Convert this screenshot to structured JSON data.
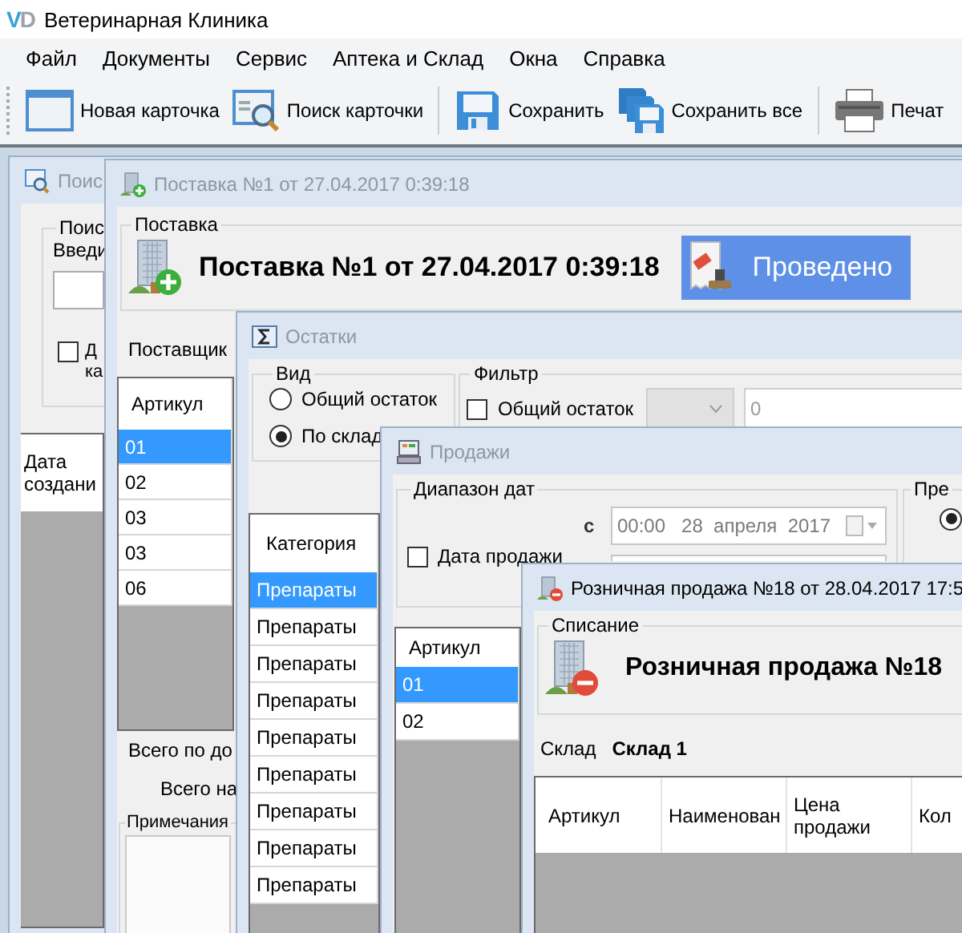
{
  "app": {
    "logo_v": "V",
    "logo_d": "D",
    "title": "Ветеринарная Клиника"
  },
  "menu": [
    "Файл",
    "Документы",
    "Сервис",
    "Аптека и Склад",
    "Окна",
    "Справка"
  ],
  "toolbar": [
    [
      {
        "label": "Новая карточка"
      },
      {
        "label": "Поиск карточки"
      }
    ],
    [
      {
        "label": "Сохранить"
      },
      {
        "label": "Сохранить все"
      }
    ],
    [
      {
        "label": "Печат"
      }
    ]
  ],
  "windows": [
    {
      "kind": "search",
      "title": "Поис",
      "active": false,
      "group_label": "Поис",
      "prompt": "Введи",
      "checked": false,
      "check_label_lines": [
        "Д",
        "ка"
      ],
      "table": {
        "columns": [
          "Дата создани"
        ]
      }
    },
    {
      "kind": "supply",
      "title": "Поставка №1 от 27.04.2017 0:39:18",
      "active": false,
      "group_label": "Поставка",
      "heading": "Поставка №1 от 27.04.2017 0:39:18",
      "status": "Проведено",
      "supplier_label": "Поставщик",
      "table": {
        "columns": [
          "Артикул"
        ],
        "rows": [
          {
            "cells": [
              "01"
            ],
            "selected": true
          },
          {
            "cells": [
              "02"
            ],
            "selected": false
          },
          {
            "cells": [
              "03"
            ],
            "selected": false
          },
          {
            "cells": [
              "03"
            ],
            "selected": false
          },
          {
            "cells": [
              "06"
            ],
            "selected": false
          }
        ]
      },
      "total_doc": "Всего по до",
      "total_sum": "Всего на",
      "notes_label": "Примечания"
    },
    {
      "kind": "stock",
      "title": "Остатки",
      "active": false,
      "view_label": "Вид",
      "view_options": [
        {
          "label": "Общий остаток",
          "selected": false
        },
        {
          "label": "По склад",
          "selected": true
        }
      ],
      "filter_label": "Фильтр",
      "filter_check": {
        "label": "Общий остаток",
        "checked": false
      },
      "filter_value": "0",
      "table": {
        "columns": [
          "Категория"
        ],
        "rows": [
          {
            "cells": [
              "Препараты"
            ],
            "selected": true
          },
          {
            "cells": [
              "Препараты"
            ],
            "selected": false
          },
          {
            "cells": [
              "Препараты"
            ],
            "selected": false
          },
          {
            "cells": [
              "Препараты"
            ],
            "selected": false
          },
          {
            "cells": [
              "Препараты"
            ],
            "selected": false
          },
          {
            "cells": [
              "Препараты"
            ],
            "selected": false
          },
          {
            "cells": [
              "Препараты"
            ],
            "selected": false
          },
          {
            "cells": [
              "Препараты"
            ],
            "selected": false
          },
          {
            "cells": [
              "Препараты"
            ],
            "selected": false
          }
        ]
      }
    },
    {
      "kind": "sales",
      "title": "Продажи",
      "active": false,
      "range_label": "Диапазон дат",
      "date_check": {
        "label": "Дата продажи",
        "checked": false
      },
      "from_label": "с",
      "from_date": "00:00   28  апреля  2017",
      "side_label": "Пре",
      "side_radio": {
        "selected": true
      },
      "table": {
        "columns": [
          "Артикул"
        ],
        "rows": [
          {
            "cells": [
              "01"
            ],
            "selected": true
          },
          {
            "cells": [
              "02"
            ],
            "selected": false
          }
        ]
      }
    },
    {
      "kind": "retail",
      "title": "Розничная продажа №18 от 28.04.2017 17:5",
      "active": true,
      "group_label": "Списание",
      "heading": "Розничная продажа №18",
      "warehouse_label": "Склад",
      "warehouse": "Склад 1",
      "table": {
        "columns": [
          "Артикул",
          "Наименован",
          "Цена продажи",
          "Кол"
        ]
      }
    }
  ]
}
